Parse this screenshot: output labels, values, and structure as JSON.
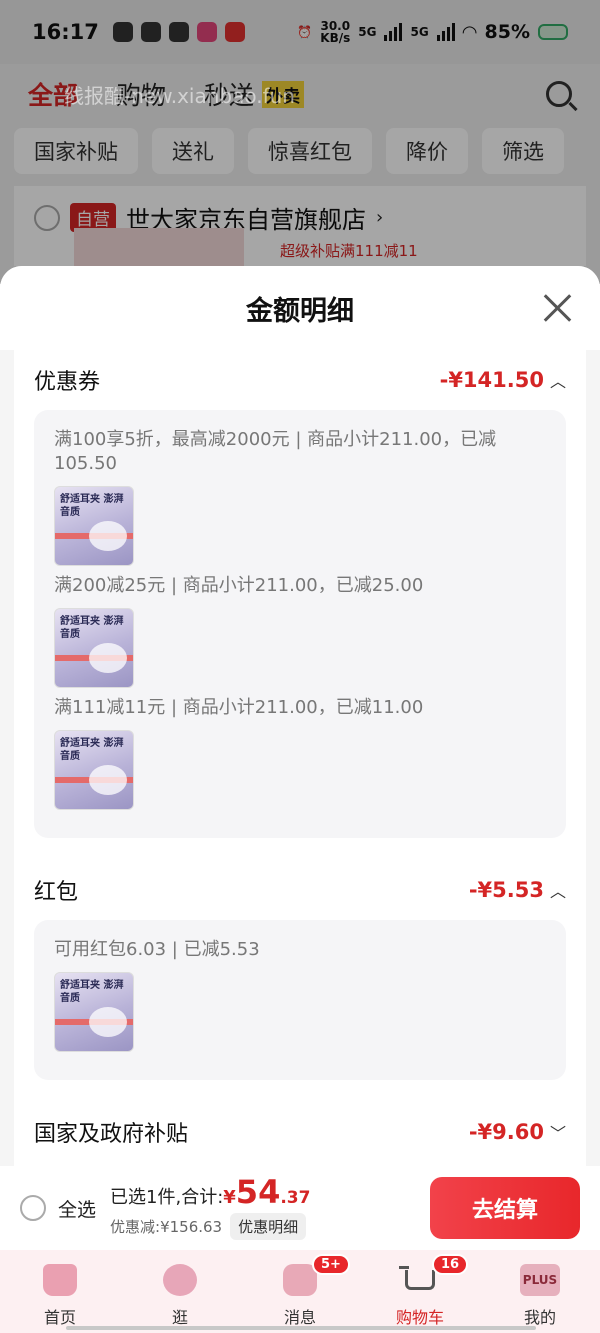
{
  "status": {
    "time": "16:17",
    "net_speed": "30.0",
    "net_unit": "KB/s",
    "net1": "5G",
    "net2": "5G",
    "battery": "85%"
  },
  "background": {
    "watermark": "线报酷-new.xianbao.fun",
    "tabs": [
      "全部",
      "购物",
      "秒送"
    ],
    "takeout_badge": "外卖",
    "filters": [
      "国家补贴",
      "送礼",
      "惊喜红包",
      "降价",
      "筛选"
    ],
    "self_badge": "自营",
    "store_name": "世大家京东自营旗舰店",
    "store_promo": "超级补贴满111减11"
  },
  "sheet": {
    "title": "金额明细",
    "coupon": {
      "label": "优惠券",
      "amount": "-¥141.50",
      "rules": [
        "满100享5折，最高减2000元 | 商品小计211.00，已减105.50",
        "满200减25元 | 商品小计211.00，已减25.00",
        "满111减11元 | 商品小计211.00，已减11.00"
      ]
    },
    "redpacket": {
      "label": "红包",
      "amount": "-¥5.53",
      "rule": "可用红包6.03 | 已减5.53"
    },
    "subsidy": {
      "label": "国家及政府补贴",
      "amount": "-¥9.60"
    },
    "product_thumb_text": "舒适耳夹 澎湃音质"
  },
  "checkout": {
    "select_all": "全选",
    "selected_text": "已选1件,合计:",
    "currency": "¥",
    "total_int": "54",
    "total_dec": ".37",
    "discount_text": "优惠减:¥156.63",
    "detail_button": "优惠明细",
    "pay_button": "去结算"
  },
  "tabbar": {
    "items": [
      {
        "label": "首页"
      },
      {
        "label": "逛"
      },
      {
        "label": "消息",
        "badge": "5+"
      },
      {
        "label": "购物车",
        "badge": "16"
      },
      {
        "label": "我的",
        "icon_text": "PLUS"
      }
    ]
  }
}
